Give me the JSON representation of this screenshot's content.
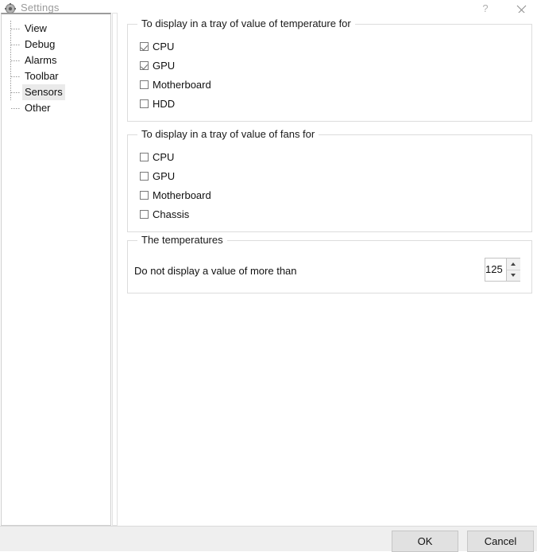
{
  "window": {
    "title": "Settings",
    "icon": "gear-icon",
    "help_label": "?",
    "close_label": "×"
  },
  "sidebar": {
    "items": [
      {
        "label": "View",
        "selected": false
      },
      {
        "label": "Debug",
        "selected": false
      },
      {
        "label": "Alarms",
        "selected": false
      },
      {
        "label": "Toolbar",
        "selected": false
      },
      {
        "label": "Sensors",
        "selected": true
      },
      {
        "label": "Other",
        "selected": false
      }
    ]
  },
  "main": {
    "groups": [
      {
        "id": "temperature",
        "title": "To display in a tray of value of temperature for",
        "checkboxes": [
          {
            "label": "CPU",
            "checked": true
          },
          {
            "label": "GPU",
            "checked": true
          },
          {
            "label": "Motherboard",
            "checked": false
          },
          {
            "label": "HDD",
            "checked": false
          }
        ]
      },
      {
        "id": "fans",
        "title": "To display in a tray of value of fans for",
        "checkboxes": [
          {
            "label": "CPU",
            "checked": false
          },
          {
            "label": "GPU",
            "checked": false
          },
          {
            "label": "Motherboard",
            "checked": false
          },
          {
            "label": "Chassis",
            "checked": false
          }
        ]
      },
      {
        "id": "thresholds",
        "title": "The temperatures",
        "field_label": "Do not display a value of more than",
        "spinner_value": "125"
      }
    ]
  },
  "footer": {
    "ok_label": "OK",
    "cancel_label": "Cancel"
  },
  "colors": {
    "selection": "#eaeaea",
    "group_border": "#dcdcdc",
    "footer_bg": "#efefef",
    "button_bg": "#e1e1e1",
    "title_text": "#9a9a9a"
  }
}
